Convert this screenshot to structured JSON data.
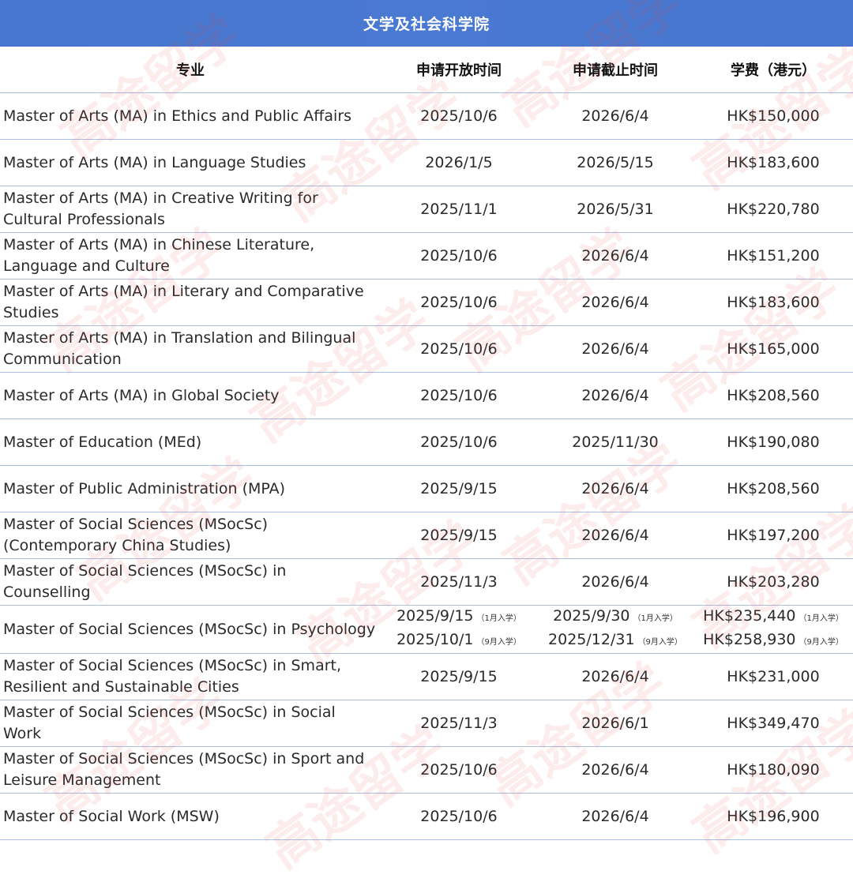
{
  "title": "文学及社会科学院",
  "headers": {
    "program": "专业",
    "open": "申请开放时间",
    "deadline": "申请截止时间",
    "fee": "学费（港元）"
  },
  "rows": [
    {
      "program": "Master of Arts (MA) in Ethics and Public Affairs",
      "open": [
        "2025/10/6"
      ],
      "deadline": [
        "2026/6/4"
      ],
      "fee": [
        "HK$150,000"
      ]
    },
    {
      "program": "Master of Arts (MA) in Language Studies",
      "open": [
        "2026/1/5"
      ],
      "deadline": [
        "2026/5/15"
      ],
      "fee": [
        "HK$183,600"
      ]
    },
    {
      "program": "Master of Arts (MA) in Creative Writing for Cultural Professionals",
      "open": [
        "2025/11/1"
      ],
      "deadline": [
        "2026/5/31"
      ],
      "fee": [
        "HK$220,780"
      ]
    },
    {
      "program": "Master of Arts (MA) in Chinese Literature, Language and Culture",
      "open": [
        "2025/10/6"
      ],
      "deadline": [
        "2026/6/4"
      ],
      "fee": [
        "HK$151,200"
      ]
    },
    {
      "program": "Master of Arts (MA) in Literary and Comparative Studies",
      "open": [
        "2025/10/6"
      ],
      "deadline": [
        "2026/6/4"
      ],
      "fee": [
        "HK$183,600"
      ]
    },
    {
      "program": "Master of Arts (MA) in Translation and Bilingual Communication",
      "open": [
        "2025/10/6"
      ],
      "deadline": [
        "2026/6/4"
      ],
      "fee": [
        "HK$165,000"
      ]
    },
    {
      "program": "Master of Arts (MA) in Global Society",
      "open": [
        "2025/10/6"
      ],
      "deadline": [
        "2026/6/4"
      ],
      "fee": [
        "HK$208,560"
      ]
    },
    {
      "program": "Master of Education (MEd)",
      "open": [
        "2025/10/6"
      ],
      "deadline": [
        "2025/11/30"
      ],
      "fee": [
        "HK$190,080"
      ]
    },
    {
      "program": "Master of Public Administration (MPA)",
      "open": [
        "2025/9/15"
      ],
      "deadline": [
        "2026/6/4"
      ],
      "fee": [
        "HK$208,560"
      ]
    },
    {
      "program": "Master of Social Sciences (MSocSc) (Contemporary China Studies)",
      "open": [
        "2025/9/15"
      ],
      "deadline": [
        "2026/6/4"
      ],
      "fee": [
        "HK$197,200"
      ]
    },
    {
      "program": "Master of Social Sciences (MSocSc) in Counselling",
      "open": [
        "2025/11/3"
      ],
      "deadline": [
        "2026/6/4"
      ],
      "fee": [
        "HK$203,280"
      ]
    },
    {
      "program": "Master of Social Sciences (MSocSc) in Psychology",
      "open": [
        "2025/9/15",
        "2025/10/1"
      ],
      "open_notes": [
        "（1月入学）",
        "（9月入学）"
      ],
      "deadline": [
        "2025/9/30",
        "2025/12/31"
      ],
      "deadline_notes": [
        "（1月入学）",
        "（9月入学）"
      ],
      "fee": [
        "HK$235,440",
        "HK$258,930"
      ],
      "fee_notes": [
        "（1月入学）",
        "（9月入学）"
      ]
    },
    {
      "program": "Master of Social Sciences (MSocSc) in Smart, Resilient and Sustainable Cities",
      "open": [
        "2025/9/15"
      ],
      "deadline": [
        "2026/6/4"
      ],
      "fee": [
        "HK$231,000"
      ]
    },
    {
      "program": "Master of Social Sciences (MSocSc) in Social Work",
      "open": [
        "2025/11/3"
      ],
      "deadline": [
        "2026/6/1"
      ],
      "fee": [
        "HK$349,470"
      ]
    },
    {
      "program": "Master of Social Sciences (MSocSc) in Sport and Leisure Management",
      "open": [
        "2025/10/6"
      ],
      "deadline": [
        "2026/6/4"
      ],
      "fee": [
        "HK$180,090"
      ]
    },
    {
      "program": "Master of Social Work (MSW)",
      "open": [
        "2025/10/6"
      ],
      "deadline": [
        "2026/6/4"
      ],
      "fee": [
        "HK$196,900"
      ]
    }
  ],
  "watermark_text": "高途留学",
  "colors": {
    "title_bar": "#4676cf",
    "row_border": "#a9bfe2",
    "watermark": "#e65046"
  }
}
